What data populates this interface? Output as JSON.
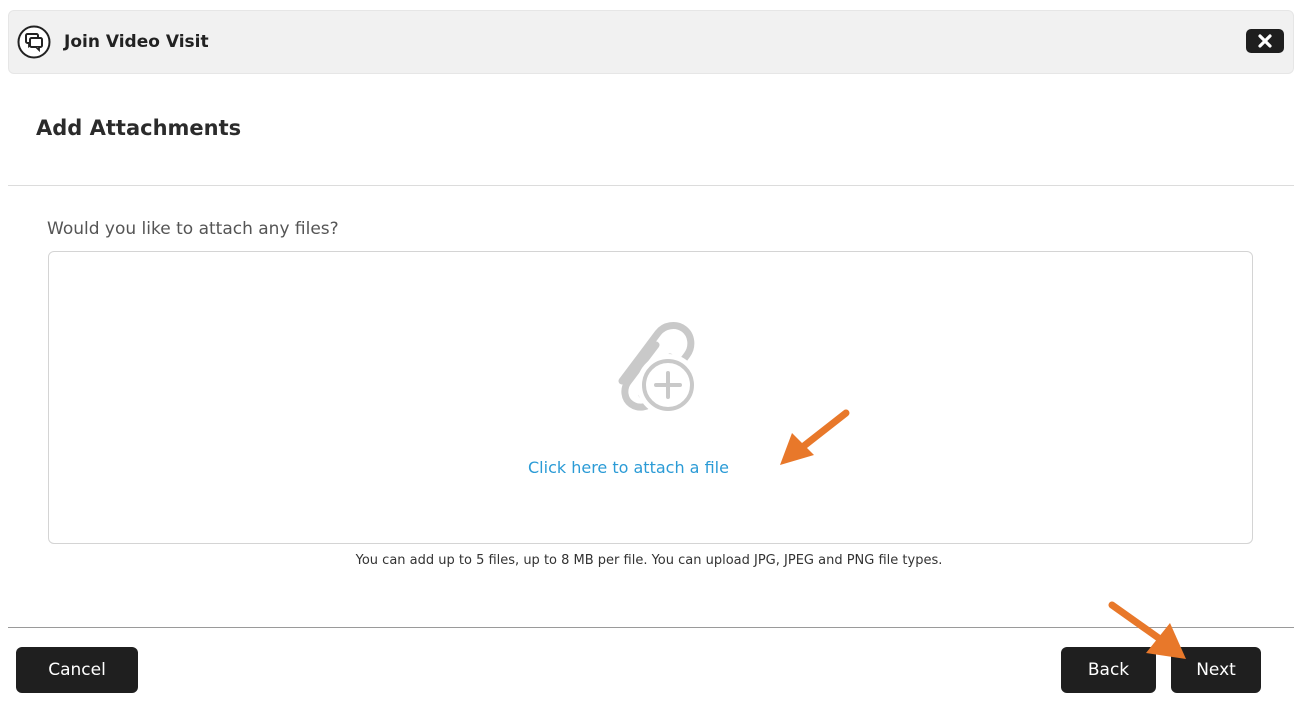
{
  "titlebar": {
    "title": "Join Video Visit",
    "icon": "chat-bubbles-icon",
    "close_icon": "close-icon"
  },
  "section": {
    "title": "Add Attachments"
  },
  "attachments": {
    "question": "Would you like to attach any files?",
    "icon": "paperclip-plus-icon",
    "link_label": "Click here to attach a file",
    "hint": "You can add up to 5 files, up to 8 MB per file. You can upload JPG, JPEG and PNG file types."
  },
  "footer": {
    "cancel_label": "Cancel",
    "back_label": "Back",
    "next_label": "Next"
  },
  "colors": {
    "link": "#2b9bd6",
    "button_bg": "#1f1f1f",
    "annotation_arrow": "#e8782a"
  }
}
